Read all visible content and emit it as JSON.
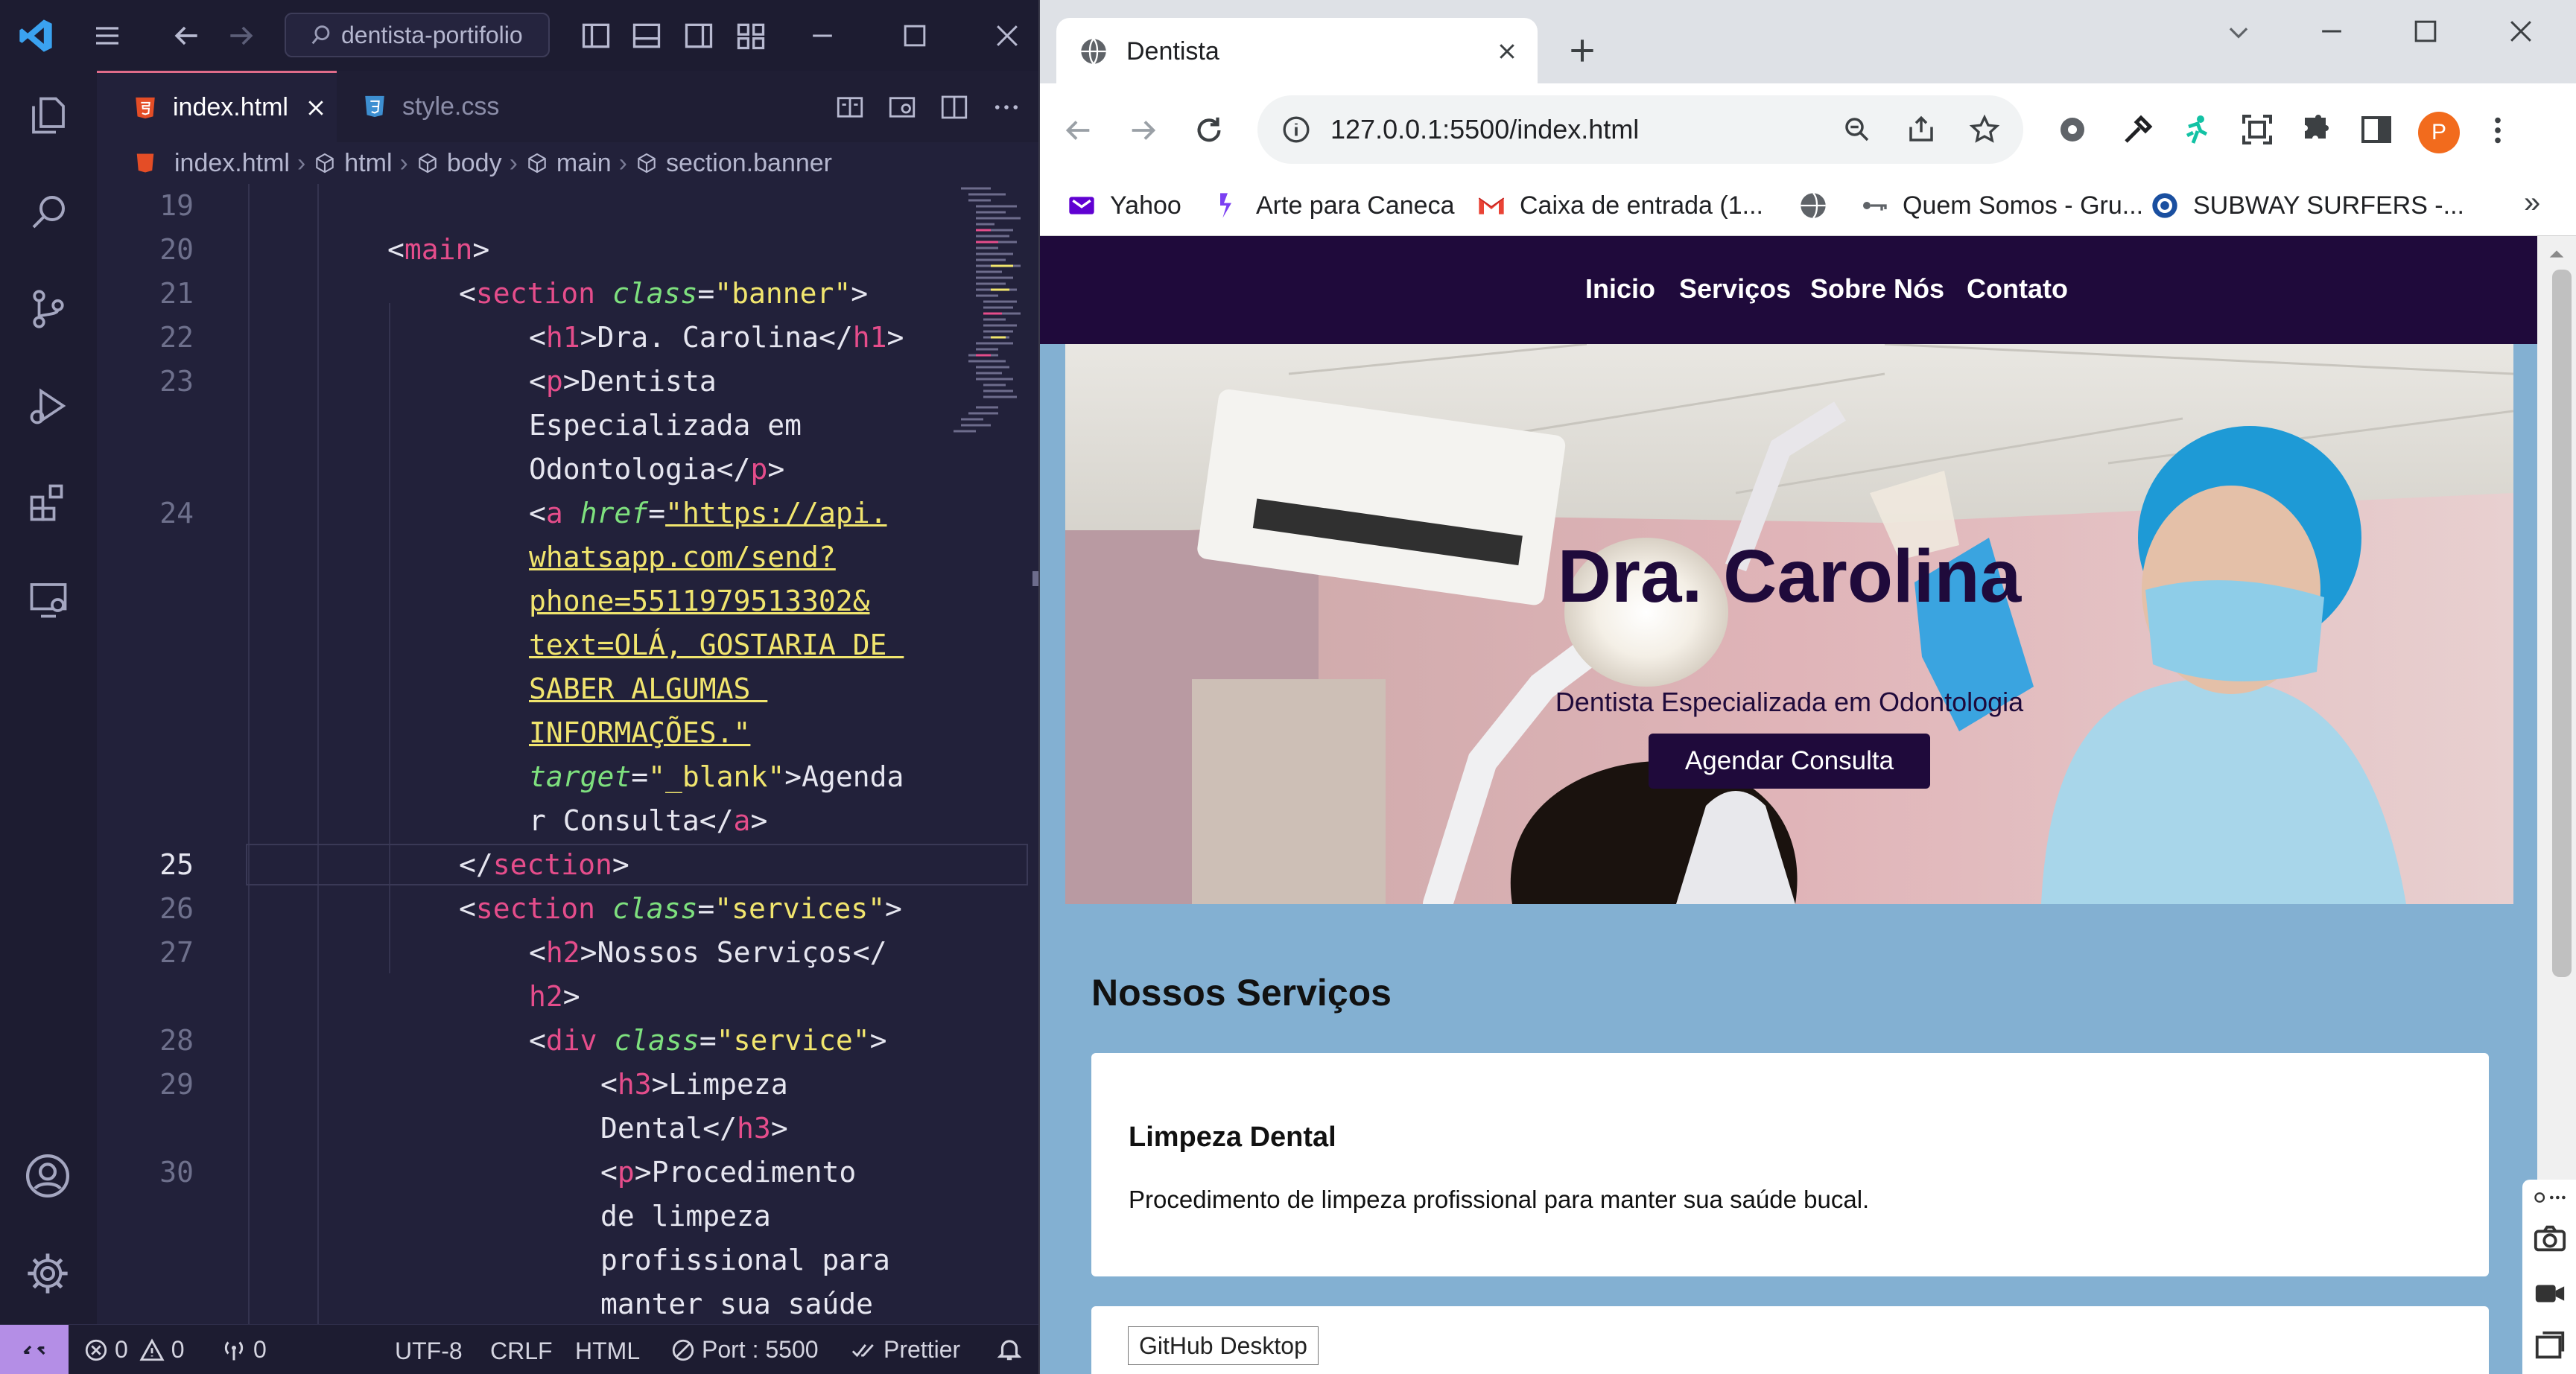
{
  "vscode": {
    "search_text": "dentista-portifolio",
    "tabs": [
      {
        "label": "index.html",
        "active": true
      },
      {
        "label": "style.css",
        "active": false
      }
    ],
    "breadcrumb": [
      "index.html",
      "html",
      "body",
      "main",
      "section.banner"
    ],
    "code_lines": [
      {
        "n": "19",
        "t": ""
      },
      {
        "n": "20",
        "t": "main"
      },
      {
        "n": "21",
        "t": "section_open"
      },
      {
        "n": "22",
        "t": "h1"
      },
      {
        "n": "23",
        "t": "p1"
      },
      {
        "n": "",
        "t": "p2"
      },
      {
        "n": "",
        "t": "p3"
      },
      {
        "n": "24",
        "t": "a1"
      },
      {
        "n": "",
        "t": "a2"
      },
      {
        "n": "",
        "t": "a3"
      },
      {
        "n": "",
        "t": "a4"
      },
      {
        "n": "",
        "t": "a5"
      },
      {
        "n": "",
        "t": "a6"
      },
      {
        "n": "",
        "t": "a7"
      },
      {
        "n": "",
        "t": "a8"
      },
      {
        "n": "25",
        "t": "section_close"
      },
      {
        "n": "26",
        "t": "section2"
      },
      {
        "n": "27",
        "t": "h2a"
      },
      {
        "n": "",
        "t": "h2b"
      },
      {
        "n": "28",
        "t": "div"
      },
      {
        "n": "29",
        "t": "h3a"
      },
      {
        "n": "",
        "t": "h3b"
      },
      {
        "n": "30",
        "t": "pa"
      },
      {
        "n": "",
        "t": "pb"
      },
      {
        "n": "",
        "t": "pc"
      },
      {
        "n": "",
        "t": "pd"
      }
    ],
    "code_text": {
      "h1_text": "Dra. Carolina",
      "p_text_1": "Dentista",
      "p_text_2": "Especializada em",
      "p_text_3": "Odontologia",
      "href_1": "\"https://api.",
      "href_2": "whatsapp.com/send?",
      "href_3": "phone=5511979513302&",
      "href_4": "text=OLÁ, GOSTARIA DE ",
      "href_5": "SABER ALGUMAS ",
      "href_6": "INFORMAÇÕES.\"",
      "target_val": "\"_blank\"",
      "link_text_1": "Agenda",
      "link_text_2": "r Consulta",
      "banner_class": "\"banner\"",
      "services_class": "\"services\"",
      "service_class": "\"service\"",
      "h2_text": "Nossos Serviços",
      "h3_text_1": "Limpeza",
      "h3_text_2": "Dental",
      "p2_text_1": "Procedimento",
      "p2_text_2": "de limpeza",
      "p2_text_3": "profissional para",
      "p2_text_4": "manter sua saúde"
    },
    "status": {
      "errors": "0",
      "warnings": "0",
      "ports": "0",
      "encoding": "UTF-8",
      "eol": "CRLF",
      "language": "HTML",
      "port": "Port : 5500",
      "formatter": "Prettier"
    }
  },
  "browser": {
    "tab_title": "Dentista",
    "url": "127.0.0.1:5500/index.html",
    "profile_initial": "P",
    "bookmarks": [
      "Yahoo",
      "Arte para Caneca",
      "Caixa de entrada (1...",
      "Quem Somos - Gru...",
      "SUBWAY SURFERS -..."
    ],
    "more_bookmarks": "»"
  },
  "site": {
    "nav": [
      "Inicio",
      "Serviços",
      "Sobre Nós",
      "Contato"
    ],
    "hero_title": "Dra. Carolina",
    "hero_subtitle": "Dentista Especializada em Odontologia",
    "cta_label": "Agendar Consulta",
    "services_title": "Nossos Serviços",
    "service_1_title": "Limpeza Dental",
    "service_1_desc": "Procedimento de limpeza profissional para manter sua saúde bucal."
  },
  "tooltip": "GitHub Desktop",
  "colors": {
    "vscode_bg": "#22213a",
    "site_nav": "#1f0a3b",
    "site_bg": "#83b0d2",
    "profile": "#f26b1d"
  }
}
